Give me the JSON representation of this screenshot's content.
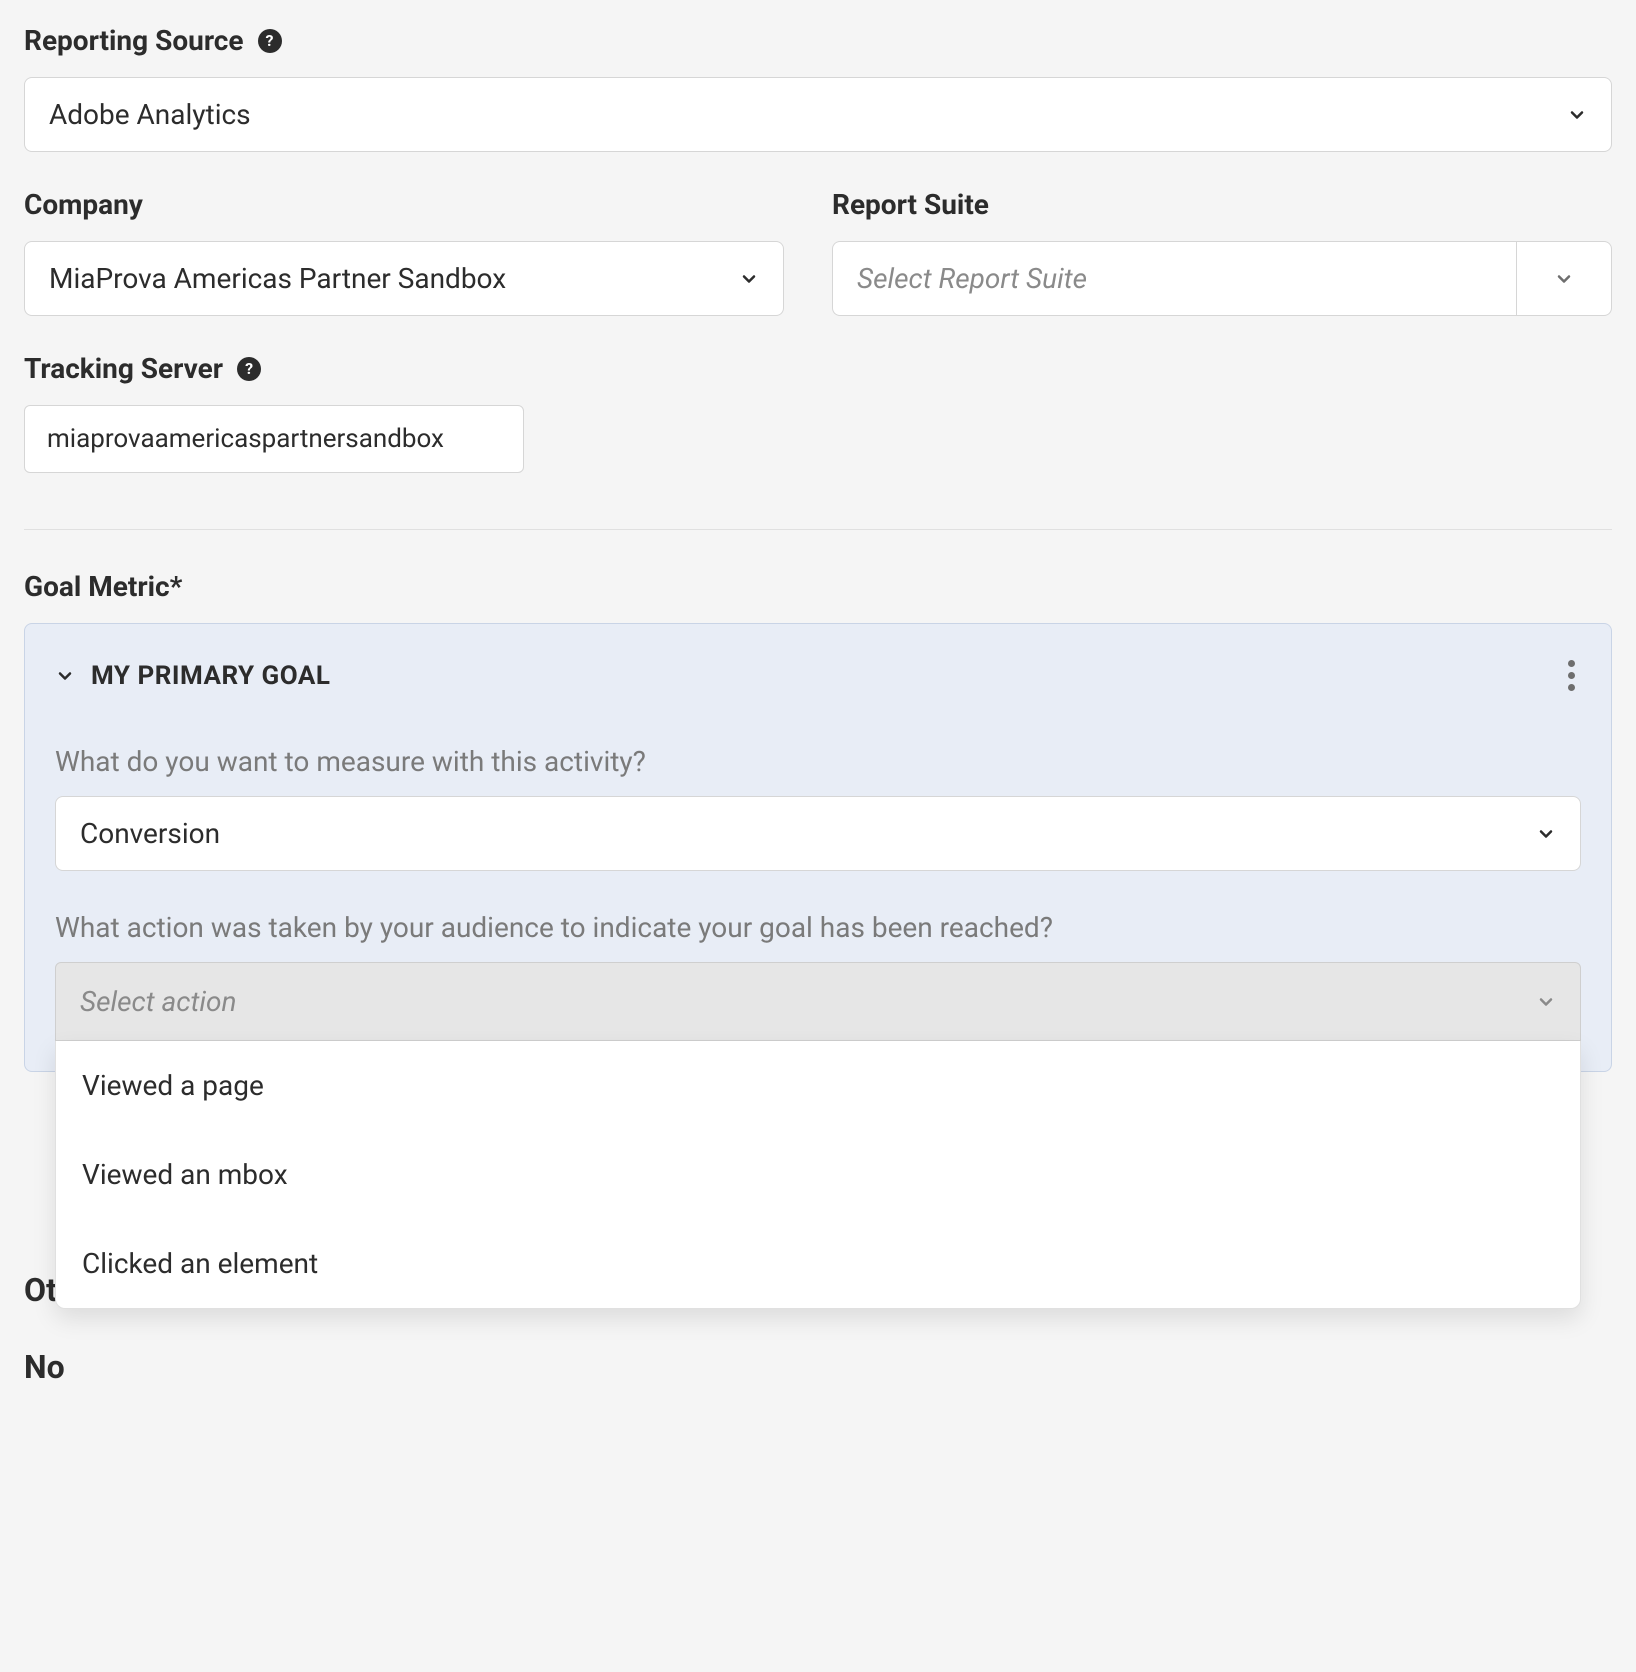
{
  "reporting_source": {
    "label": "Reporting Source",
    "value": "Adobe Analytics"
  },
  "company": {
    "label": "Company",
    "value": "MiaProva Americas Partner Sandbox"
  },
  "report_suite": {
    "label": "Report Suite",
    "placeholder": "Select Report Suite"
  },
  "tracking_server": {
    "label": "Tracking Server",
    "value": "miaprovaamericaspartnersandbox"
  },
  "goal_metric": {
    "label": "Goal Metric*",
    "card_title": "MY PRIMARY GOAL",
    "measure_prompt": "What do you want to measure with this activity?",
    "measure_value": "Conversion",
    "action_prompt": "What action was taken by your audience to indicate your goal has been reached?",
    "action_placeholder": "Select action",
    "action_options": [
      "Viewed a page",
      "Viewed an mbox",
      "Clicked an element"
    ]
  },
  "behind": {
    "other_label_fragment": "Ot",
    "notes_label_fragment": "No"
  }
}
